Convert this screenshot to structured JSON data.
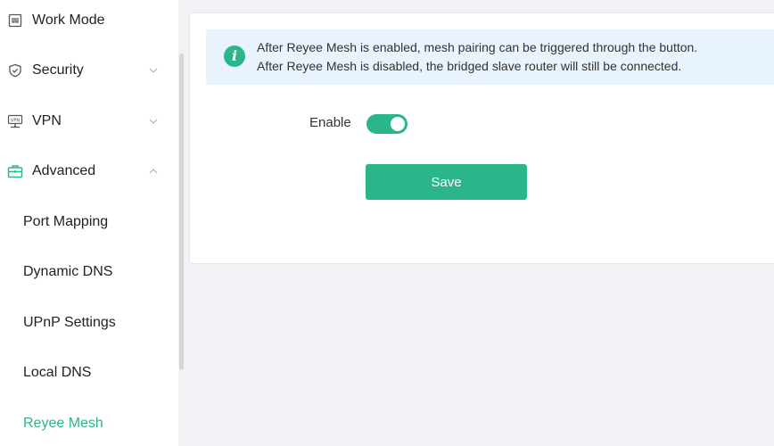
{
  "sidebar": {
    "items": [
      {
        "label": "Work Mode",
        "icon": "work-mode-icon"
      },
      {
        "label": "Security",
        "icon": "shield-icon",
        "chevron": "chevron-down-icon"
      },
      {
        "label": "VPN",
        "icon": "vpn-icon",
        "chevron": "chevron-down-icon"
      },
      {
        "label": "Advanced",
        "icon": "toolbox-icon",
        "chevron": "chevron-up-icon",
        "expanded": true
      }
    ],
    "subitems": [
      {
        "label": "Port Mapping"
      },
      {
        "label": "Dynamic DNS"
      },
      {
        "label": "UPnP Settings"
      },
      {
        "label": "Local DNS"
      },
      {
        "label": "Reyee Mesh",
        "active": true
      }
    ],
    "vpn_icon_text": "VPN"
  },
  "main": {
    "info": {
      "icon_text": "i",
      "line1": "After Reyee Mesh is enabled, mesh pairing can be triggered through the button.",
      "line2": "After Reyee Mesh is disabled, the bridged slave router will still be connected."
    },
    "enable_label": "Enable",
    "enable_toggle_on": true,
    "save_label": "Save"
  },
  "colors": {
    "accent": "#2bb58a",
    "info_bg": "#e8f3fd",
    "page_bg": "#f0f2f5"
  }
}
